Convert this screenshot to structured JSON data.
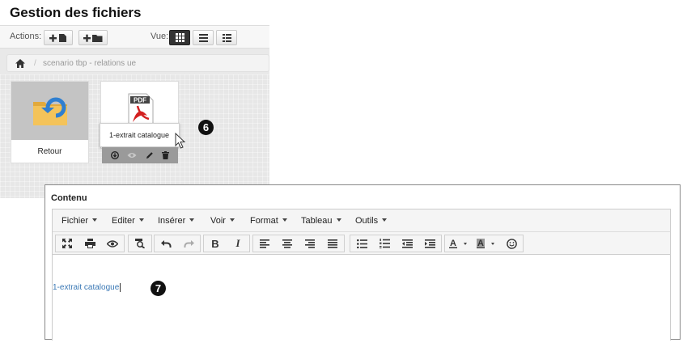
{
  "file_manager": {
    "title": "Gestion des fichiers",
    "actions_label": "Actions:",
    "view_label": "Vue:",
    "breadcrumb": {
      "path": "scenario tbp - relations ue"
    },
    "items": [
      {
        "label": "Retour",
        "icon": "folder-back-icon"
      },
      {
        "label": "1-extrait catalogue",
        "icon": "pdf-icon"
      }
    ],
    "tooltip": "1-extrait catalogue",
    "callout": "6"
  },
  "editor": {
    "title": "Contenu",
    "menus": [
      "Fichier",
      "Editer",
      "Insérer",
      "Voir",
      "Format",
      "Tableau",
      "Outils"
    ],
    "bold_label": "B",
    "italic_label": "I",
    "content_text": "1-extrait catalogue",
    "callout": "7"
  },
  "colors": {
    "link": "#3a78b5",
    "active_view": "#333333",
    "tile_thumb": "#c4c4c4"
  }
}
